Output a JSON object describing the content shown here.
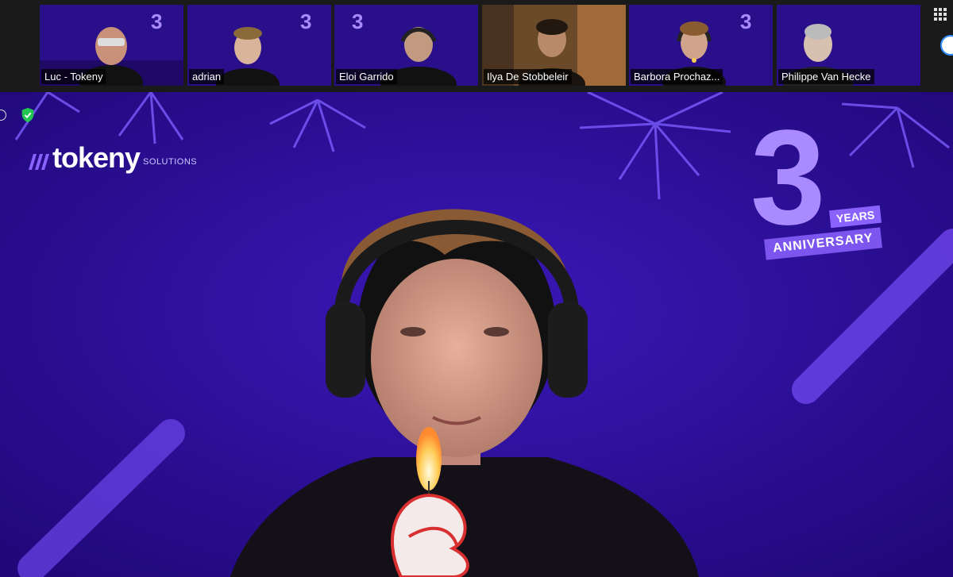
{
  "participants": [
    {
      "name": "Luc - Tokeny"
    },
    {
      "name": "adrian"
    },
    {
      "name": "Eloi Garrido"
    },
    {
      "name": "Ilya De Stobbeleir"
    },
    {
      "name": "Barbora Prochaz..."
    },
    {
      "name": "Philippe Van Hecke"
    }
  ],
  "background": {
    "logo_word": "tokeny",
    "logo_sub": "SOLUTIONS",
    "anniversary_number": "3",
    "anniversary_years": "YEARS",
    "anniversary_label": "ANNIVERSARY"
  },
  "colors": {
    "background_purple": "#2a0f8a",
    "accent_purple": "#8a63ff",
    "active_speaker_outline": "#c9e68a",
    "security_green": "#23c552"
  },
  "icons": {
    "grid_view": "grid-view-icon",
    "security": "shield-check-icon"
  }
}
